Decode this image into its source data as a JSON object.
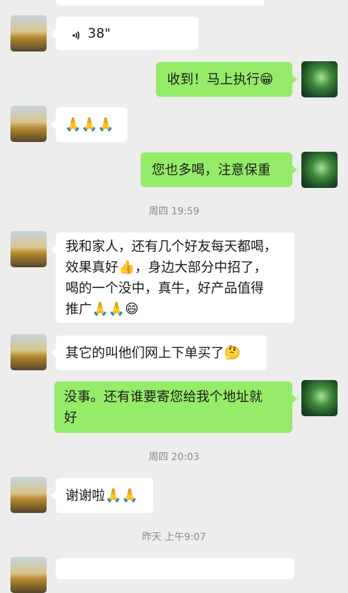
{
  "messages": {
    "m1_voice": "38\"",
    "m2": "收到！马上执行😁",
    "m3": "🙏🙏🙏",
    "m4": "您也多喝，注意保重",
    "t1": "周四 19:59",
    "m5_l1": "我和家人，还有几个好友每天都喝，",
    "m5_l2": "效果真好👍，身边大部分中招了，",
    "m5_l3": "喝的一个没中，真牛，好产品值得",
    "m5_l4": "推广🙏🙏😄",
    "m6": "其它的叫他们网上下单买了🤔",
    "m7_l1": "没事。还有谁要寄您给我个地址就",
    "m7_l2": "好",
    "t2": "周四 20:03",
    "m8": "谢谢啦🙏🙏",
    "t3": "昨天 上午9:07"
  },
  "colors": {
    "background": "#ededed",
    "incoming_bubble": "#ffffff",
    "outgoing_bubble": "#95ec69",
    "timestamp": "#8a8a8a"
  },
  "icons": {
    "voice": "voice-wave-icon",
    "avatar_left": "sunset-landscape-avatar",
    "avatar_right": "green-forest-avatar"
  }
}
